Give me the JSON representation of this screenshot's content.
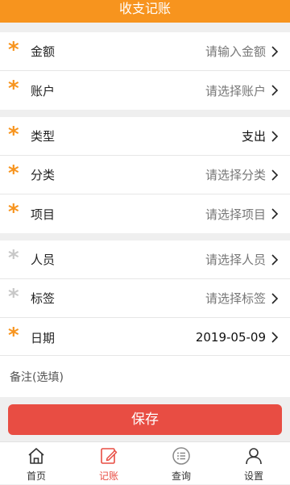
{
  "header": {
    "title": "收支记账"
  },
  "form": {
    "group1": [
      {
        "label": "金额",
        "value": "请输入金额"
      },
      {
        "label": "账户",
        "value": "请选择账户"
      }
    ],
    "group2": [
      {
        "label": "类型",
        "value": "支出"
      },
      {
        "label": "分类",
        "value": "请选择分类"
      },
      {
        "label": "项目",
        "value": "请选择项目"
      }
    ],
    "group3": [
      {
        "label": "人员",
        "value": "请选择人员"
      },
      {
        "label": "标签",
        "value": "请选择标签"
      },
      {
        "label": "日期",
        "value": "2019-05-09"
      }
    ],
    "note": "备注(选填)"
  },
  "save_label": "保存",
  "tabs": [
    {
      "label": "首页",
      "icon": "home-icon"
    },
    {
      "label": "记账",
      "icon": "edit-icon"
    },
    {
      "label": "查询",
      "icon": "list-icon"
    },
    {
      "label": "设置",
      "icon": "user-icon"
    }
  ],
  "colors": {
    "accent": "#f7941e",
    "save": "#e84d43",
    "required": "#f7941e",
    "optional": "#c8c8c8"
  }
}
